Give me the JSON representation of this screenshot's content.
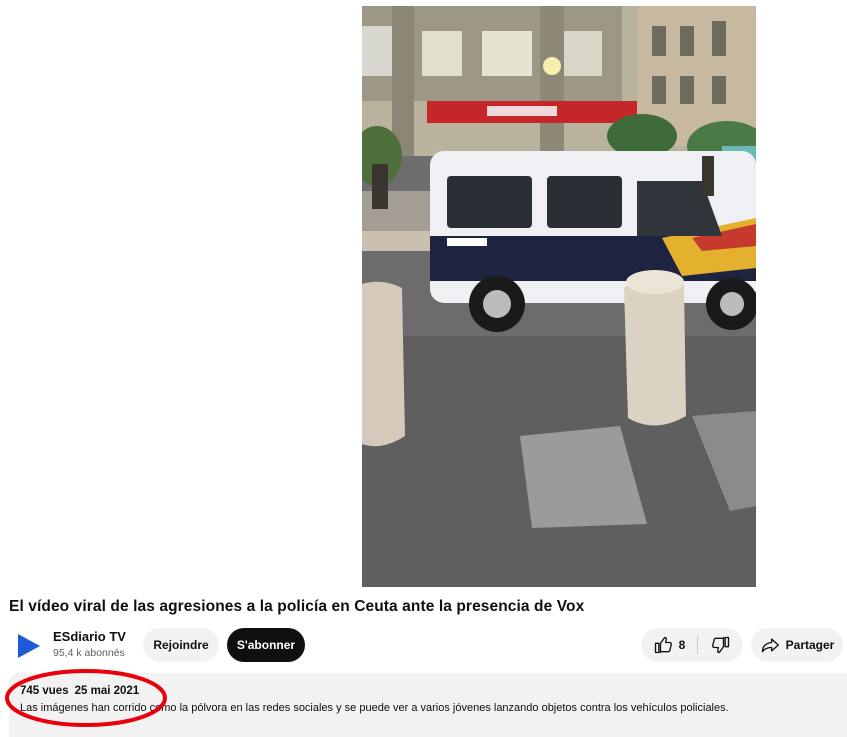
{
  "video": {
    "thumbnail_icon": "video-frame"
  },
  "title": "El vídeo viral de las agresiones a la policía en Ceuta ante la presencia de Vox",
  "channel": {
    "name": "ESdiario TV",
    "subscribers": "95,4 k abonnés",
    "logo_icon": "play-triangle-logo",
    "logo_color": "#1f5ad8"
  },
  "actions": {
    "join_label": "Rejoindre",
    "subscribe_label": "S'abonner",
    "like_count": "8",
    "like_icon": "thumbs-up-icon",
    "dislike_icon": "thumbs-down-icon",
    "share_label": "Partager",
    "share_icon": "share-arrow-icon"
  },
  "description": {
    "views": "745 vues",
    "date": "25 mai 2021",
    "text": "Las imágenes han corrido como la pólvora en las redes sociales y se puede ver a varios jóvenes lanzando objetos contra los vehículos policiales."
  },
  "annotation": {
    "color": "#e8000b"
  }
}
